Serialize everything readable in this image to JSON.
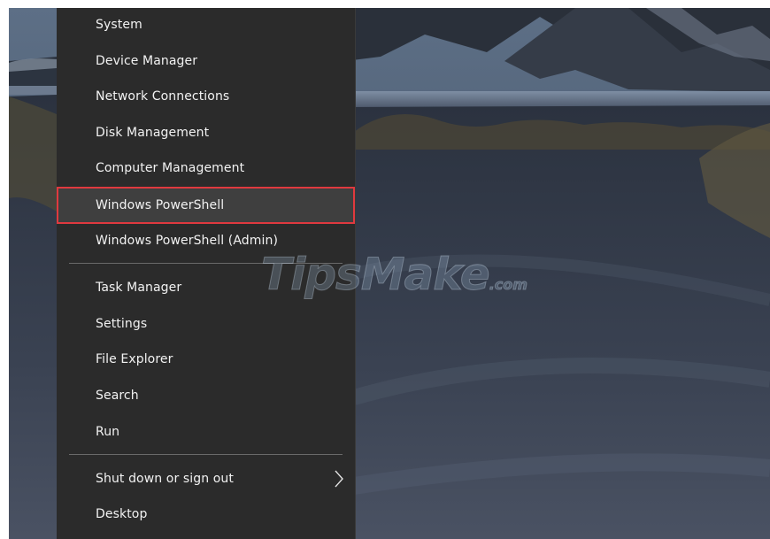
{
  "menu": {
    "items": [
      {
        "label": "System"
      },
      {
        "label": "Device Manager"
      },
      {
        "label": "Network Connections"
      },
      {
        "label": "Disk Management"
      },
      {
        "label": "Computer Management"
      },
      {
        "label": "Windows PowerShell",
        "highlighted": true
      },
      {
        "label": "Windows PowerShell (Admin)"
      },
      {
        "label": "Task Manager"
      },
      {
        "label": "Settings"
      },
      {
        "label": "File Explorer"
      },
      {
        "label": "Search"
      },
      {
        "label": "Run"
      },
      {
        "label": "Shut down or sign out",
        "submenu": true
      },
      {
        "label": "Desktop"
      }
    ]
  },
  "watermark": {
    "text": "TipsMake",
    "suffix": ".com"
  },
  "colors": {
    "menu_background": "#2b2b2b",
    "menu_text": "#f2f2f2",
    "highlight_background": "#3f3f3f",
    "highlight_border": "#e0393f",
    "separator": "#6a6a6a"
  }
}
